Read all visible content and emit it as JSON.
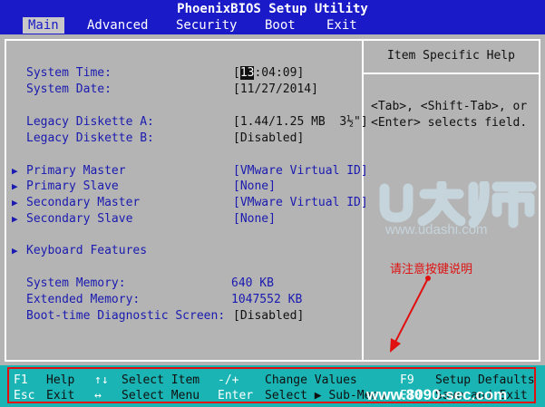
{
  "header": {
    "title": "PhoenixBIOS Setup Utility",
    "menu": [
      "Main",
      "Advanced",
      "Security",
      "Boot",
      "Exit"
    ]
  },
  "main": {
    "system_time_label": "System Time:",
    "system_time_cursor": "13",
    "system_time_rest": ":04:09]",
    "system_date_label": "System Date:",
    "system_date_value": "[11/27/2014]",
    "diskette_a_label": "Legacy Diskette A:",
    "diskette_a_value": "[1.44/1.25 MB  3½\"]",
    "diskette_b_label": "Legacy Diskette B:",
    "diskette_b_value": "[Disabled]",
    "primary_master_label": "Primary Master",
    "primary_master_value": "[VMware Virtual ID]",
    "primary_slave_label": "Primary Slave",
    "primary_slave_value": "[None]",
    "secondary_master_label": "Secondary Master",
    "secondary_master_value": "[VMware Virtual ID]",
    "secondary_slave_label": "Secondary Slave",
    "secondary_slave_value": "[None]",
    "keyboard_label": "Keyboard Features",
    "system_memory_label": "System Memory:",
    "system_memory_value": "640 KB",
    "extended_memory_label": "Extended Memory:",
    "extended_memory_value": "1047552 KB",
    "boot_diag_label": "Boot-time Diagnostic Screen:",
    "boot_diag_value": "[Disabled]"
  },
  "help": {
    "title": "Item Specific Help",
    "line1": "<Tab>, <Shift-Tab>, or",
    "line2": "<Enter> selects field."
  },
  "watermark": {
    "logo_text": "U大师",
    "url": "www.udashi.com",
    "bottom": "www.8090-sec.com"
  },
  "annotation": {
    "note": "请注意按键说明"
  },
  "footer": {
    "r1": [
      "F1",
      "Help",
      "↑↓",
      "Select Item",
      "-/+",
      "Change Values",
      "F9",
      "Setup Defaults"
    ],
    "r2": [
      "Esc",
      "Exit",
      "↔",
      "Select Menu",
      "Enter",
      "Select ▶ Sub-Menu",
      "F10",
      "Save and Exit"
    ]
  },
  "colors": {
    "title_bar": "#1a1ac8",
    "background": "#b4b4b4",
    "footer_bar": "#1ab4b4",
    "label_blue": "#1a1ab0",
    "annotation_red": "#e01010"
  },
  "icons": {
    "submenu_arrow": "triangle-right-icon",
    "annotation_arrow": "arrow-icon"
  }
}
